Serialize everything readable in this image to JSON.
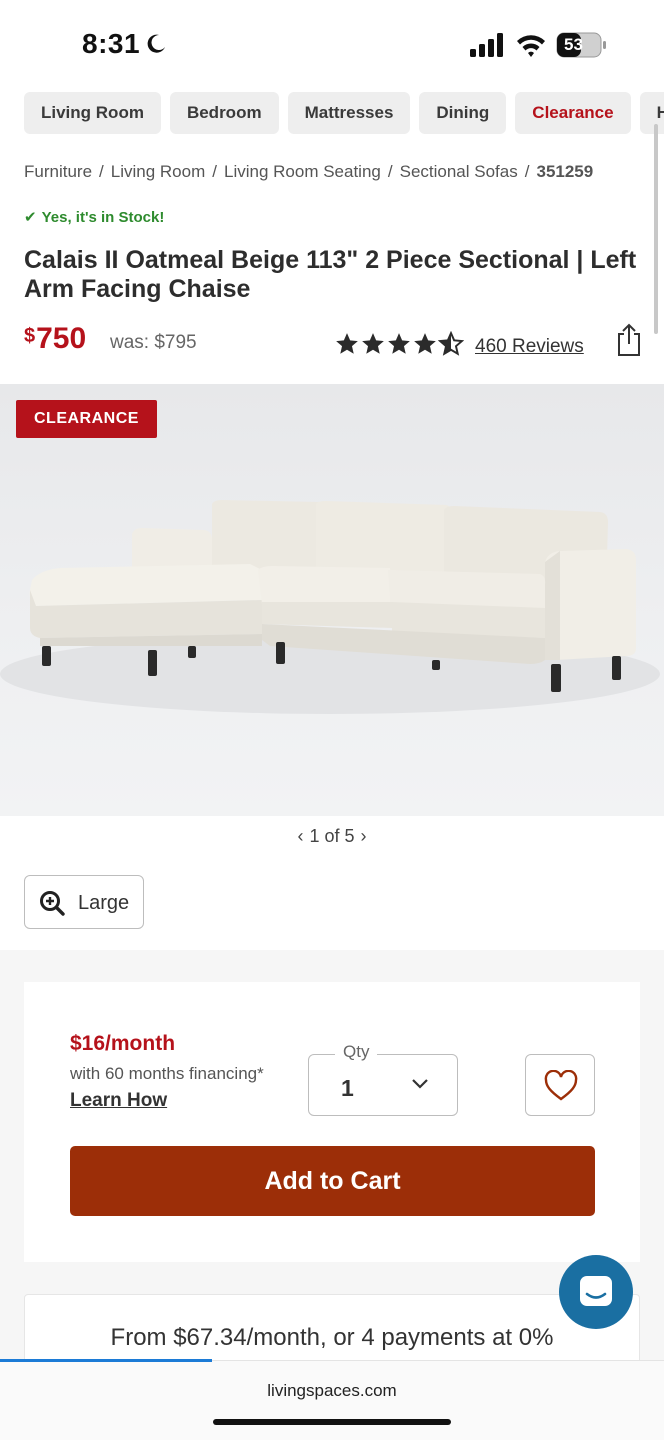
{
  "status_bar": {
    "time": "8:31",
    "battery": "53"
  },
  "nav": {
    "categories": [
      "Living Room",
      "Bedroom",
      "Mattresses",
      "Dining",
      "Clearance",
      "Home"
    ]
  },
  "breadcrumb": {
    "items": [
      "Furniture",
      "Living Room",
      "Living Room Seating",
      "Sectional Sofas"
    ],
    "separator": "/",
    "sku": "351259"
  },
  "stock": {
    "check": "✔",
    "text": "Yes, it's in Stock!"
  },
  "product": {
    "title": "Calais II Oatmeal Beige 113\" 2 Piece Sectional | Left Arm Facing Chaise",
    "currency": "$",
    "price": "750",
    "was_price": "was: $795",
    "rating": 4.5,
    "reviews": "460 Reviews"
  },
  "gallery": {
    "badge": "CLEARANCE",
    "pager": "1 of 5",
    "prev": "‹",
    "next": "›",
    "zoom_label": "Large"
  },
  "purchase": {
    "monthly": "$16/month",
    "financing_note": "with 60 months financing*",
    "learn_link": "Learn How",
    "qty_label": "Qty",
    "qty_value": "1",
    "add_to_cart": "Add to Cart"
  },
  "payments": {
    "text": "From $67.34/month, or 4 payments at 0%"
  },
  "browser": {
    "url": "livingspaces.com",
    "load_progress": 0.32
  },
  "colors": {
    "accent_red": "#b5121b",
    "cart_button": "#9c2e08",
    "stock_green": "#2e8b2e",
    "chat_blue": "#1a6fa2"
  }
}
